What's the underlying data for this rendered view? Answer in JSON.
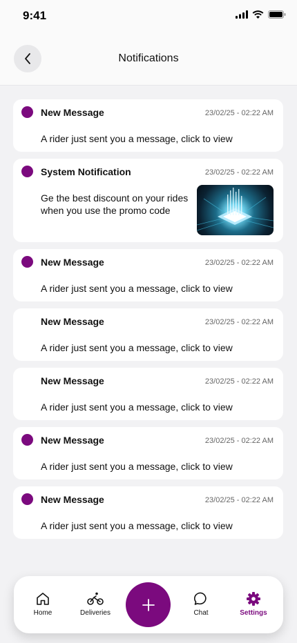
{
  "status_bar": {
    "time": "9:41"
  },
  "header": {
    "title": "Notifications"
  },
  "notifications": [
    {
      "title": "New Message",
      "time": "23/02/25 - 02:22 AM",
      "body": "A rider just sent you a message, click to view",
      "unread": true
    },
    {
      "title": "System Notification",
      "time": "23/02/25 - 02:22 AM",
      "body": "Ge the best discount on your rides when you use the promo code",
      "unread": true,
      "image": "circuit-chip-image"
    },
    {
      "title": "New Message",
      "time": "23/02/25 - 02:22 AM",
      "body": "A rider just sent you a message, click to view",
      "unread": true
    },
    {
      "title": "New Message",
      "time": "23/02/25 - 02:22 AM",
      "body": "A rider just sent you a message, click to view",
      "unread": false
    },
    {
      "title": "New Message",
      "time": "23/02/25 - 02:22 AM",
      "body": "A rider just sent you a message, click to view",
      "unread": false
    },
    {
      "title": "New Message",
      "time": "23/02/25 - 02:22 AM",
      "body": "A rider just sent you a message, click to view",
      "unread": true
    },
    {
      "title": "New Message",
      "time": "23/02/25 - 02:22 AM",
      "body": "A rider just sent you a message, click to view",
      "unread": true
    }
  ],
  "bottom_nav": {
    "items": [
      {
        "label": "Home",
        "icon": "home-icon"
      },
      {
        "label": "Deliveries",
        "icon": "bicycle-icon"
      },
      {
        "label": "Chat",
        "icon": "chat-bubble-icon"
      },
      {
        "label": "Settings",
        "icon": "gear-icon",
        "active": true
      }
    ],
    "fab_icon": "plus-icon"
  },
  "colors": {
    "accent": "#7b0a7e",
    "background": "#f2f2f4",
    "card": "#ffffff"
  }
}
